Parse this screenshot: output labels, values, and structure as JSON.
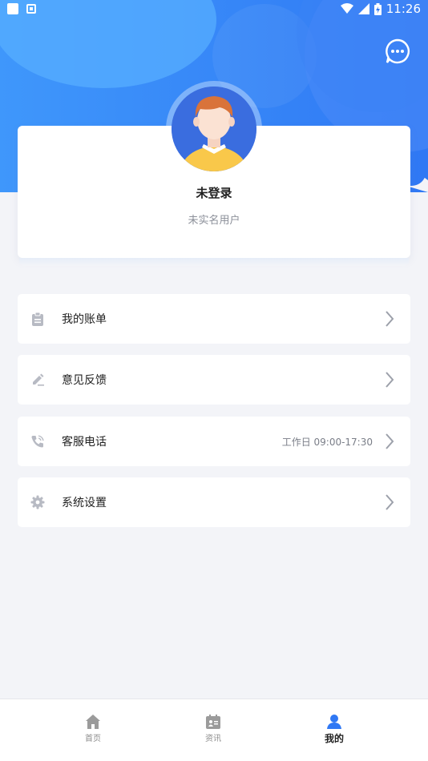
{
  "status_bar": {
    "time": "11:26"
  },
  "colors": {
    "brand_blue": "#2f78f4",
    "light_blue": "#5aa5ff",
    "background": "#f3f4f8",
    "icon_gray": "#b7bac3"
  },
  "header": {
    "message_icon": "chat-bubble-icon"
  },
  "profile": {
    "name": "未登录",
    "subtitle": "未实名用户",
    "avatar_icon": "default-avatar"
  },
  "menu": [
    {
      "label": "我的账单",
      "icon": "clipboard-icon",
      "extra": ""
    },
    {
      "label": "意见反馈",
      "icon": "pencil-icon",
      "extra": ""
    },
    {
      "label": "客服电话",
      "icon": "phone-icon",
      "extra": "工作日 09:00-17:30"
    },
    {
      "label": "系统设置",
      "icon": "gear-icon",
      "extra": ""
    }
  ],
  "bottom_nav": [
    {
      "label": "首页",
      "icon": "home-icon",
      "active": false
    },
    {
      "label": "资讯",
      "icon": "news-icon",
      "active": false
    },
    {
      "label": "我的",
      "icon": "user-icon",
      "active": true
    }
  ]
}
